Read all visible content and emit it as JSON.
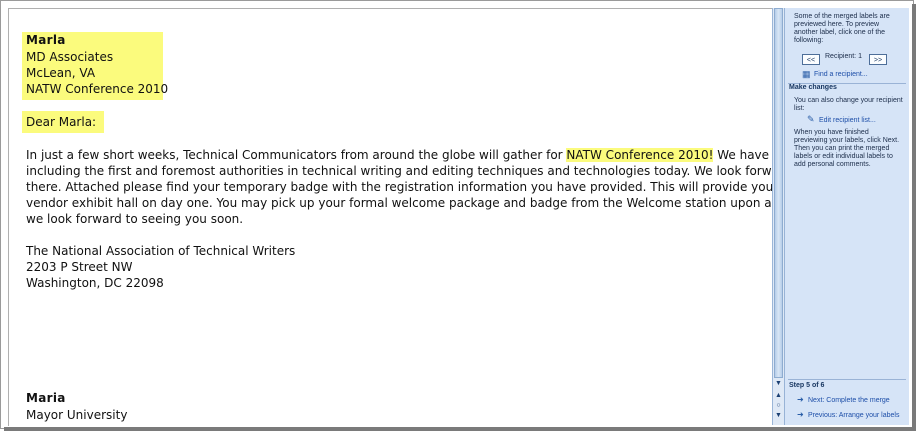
{
  "document": {
    "record1": {
      "name": "Marla",
      "company": "MD Associates",
      "city": "McLean, VA",
      "event": "NATW Conference 2010"
    },
    "greeting": "Dear Marla:",
    "body": {
      "line1_pre": "In just a few short weeks, Technical Communicators from around the globe will gather for ",
      "line1_hl": "NATW Conference 2010!",
      "line1_post": "  We have lots in store fo",
      "line2": "including the first and foremost authorities in technical writing and editing techniques and technologies today.  We look forward to seeing y",
      "line3": "there.  Attached please find your temporary badge with the registration information you have provided.  This will provide you early access t",
      "line4": "vendor exhibit hall on day one.  You may pick up your formal welcome package and badge from the Welcome station upon arrival.  Once ag",
      "line5": "we look forward to seeing you soon."
    },
    "signature": {
      "org": "The National Association of Technical Writers",
      "street": "2203 P Street NW",
      "city": "Washington, DC 22098"
    },
    "record2": {
      "name": "Maria",
      "company": "Mayor University"
    }
  },
  "task_pane": {
    "intro": "Some of the merged labels are previewed here. To preview another label, click one of the following:",
    "prev_button": "<<",
    "recipient_label": "Recipient: 1",
    "next_button": ">>",
    "find_recipient": "Find a recipient...",
    "make_changes_heading": "Make changes",
    "change_text": "You can also change your recipient list:",
    "edit_recipient_list": "Edit recipient list...",
    "finish_text": "When you have finished previewing your labels, click Next. Then you can print the merged labels or edit individual labels to add personal comments.",
    "step_label": "Step 5 of 6",
    "next_step": "Next: Complete the merge",
    "previous_step": "Previous: Arrange your labels"
  },
  "scrollbar": {
    "down_arrow": "▼",
    "prev_page": "▲",
    "select_browse": "○",
    "next_page": "▼"
  },
  "colors": {
    "highlight": "#fbfb7d",
    "pane_background": "#d6e4f7",
    "link": "#1d4ea8"
  }
}
